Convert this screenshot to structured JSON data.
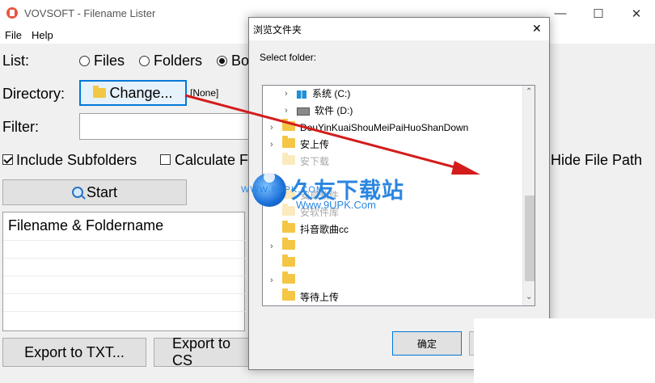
{
  "window": {
    "title": "VOVSOFT - Filename Lister",
    "minimize_glyph": "—",
    "maximize_glyph": "☐",
    "close_glyph": "✕"
  },
  "menu": [
    "File",
    "Help"
  ],
  "list_row": {
    "label": "List:",
    "options": [
      "Files",
      "Folders",
      "Bo"
    ],
    "selected": "Both"
  },
  "directory": {
    "label": "Directory:",
    "button": "Change...",
    "value": "[None]"
  },
  "filter": {
    "label": "Filter:",
    "value": ""
  },
  "options": {
    "include_subfolders": "Include Subfolders",
    "include_subfolders_checked": true,
    "calculate": "Calculate F",
    "calculate_checked": false,
    "hide_file_path": "Hide File Path"
  },
  "start_button": "Start",
  "results": {
    "header": "Filename & Foldername"
  },
  "export": {
    "txt": "Export to TXT...",
    "csv": "Export to CS"
  },
  "dialog": {
    "title": "浏览文件夹",
    "close_glyph": "✕",
    "prompt": "Select folder:",
    "ok": "确定",
    "tree": [
      {
        "label": "系统 (C:)",
        "kind": "drive-c"
      },
      {
        "label": "软件 (D:)",
        "kind": "drive"
      },
      {
        "label": "DouYinKuaiShouMeiPaiHuoShanDown",
        "kind": "folder"
      },
      {
        "label": "安上传",
        "kind": "folder"
      },
      {
        "label": "安下载",
        "kind": "folder-faded"
      },
      {
        "label": "安卓软件",
        "kind": "folder-faded"
      },
      {
        "label": "安软件库",
        "kind": "folder-faded"
      },
      {
        "label": "抖音歌曲cc",
        "kind": "folder"
      },
      {
        "label": "",
        "kind": "folder"
      },
      {
        "label": "",
        "kind": "folder"
      },
      {
        "label": "",
        "kind": "folder"
      },
      {
        "label": "等待上传",
        "kind": "folder"
      }
    ]
  },
  "watermark": {
    "title": "久友下载站",
    "url": "Www.9UPK.Com",
    "prefix": "WWW.9UPK.COM"
  },
  "colors": {
    "accent": "#0078d7",
    "folder": "#f4c645",
    "arrow": "#d41c1c",
    "watermark": "#2a86e0"
  }
}
